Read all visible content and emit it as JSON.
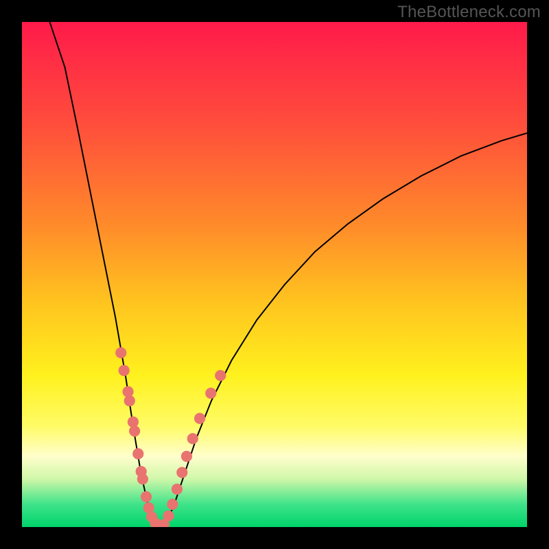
{
  "watermark": "TheBottleneck.com",
  "colors": {
    "gradient_stops": [
      {
        "pos": 0.0,
        "hex": "#ff1a4a"
      },
      {
        "pos": 0.2,
        "hex": "#ff4d3c"
      },
      {
        "pos": 0.4,
        "hex": "#ff8a2a"
      },
      {
        "pos": 0.55,
        "hex": "#ffc21f"
      },
      {
        "pos": 0.7,
        "hex": "#fff11e"
      },
      {
        "pos": 0.8,
        "hex": "#fffb66"
      },
      {
        "pos": 0.86,
        "hex": "#fffecc"
      },
      {
        "pos": 0.905,
        "hex": "#cff7a8"
      },
      {
        "pos": 0.955,
        "hex": "#3fe38a"
      },
      {
        "pos": 1.0,
        "hex": "#00d46a"
      }
    ],
    "curve": "#000000",
    "dot": "#e9736f",
    "frame": "#000000"
  },
  "chart_data": {
    "type": "line",
    "title": "",
    "xlabel": "",
    "ylabel": "",
    "xlim": [
      0,
      1
    ],
    "ylim": [
      0,
      1
    ],
    "series": [
      {
        "name": "bottleneck-curve",
        "description": "V-shaped bottleneck curve; y≈1 at x≈0, drops near-vertically to y≈0 at x≈0.26, then rises with diminishing slope toward y≈0.77 at x=1.",
        "points": [
          {
            "x": 0.055,
            "y": 1.0
          },
          {
            "x": 0.085,
            "y": 0.91
          },
          {
            "x": 0.11,
            "y": 0.79
          },
          {
            "x": 0.135,
            "y": 0.665
          },
          {
            "x": 0.16,
            "y": 0.54
          },
          {
            "x": 0.185,
            "y": 0.415
          },
          {
            "x": 0.205,
            "y": 0.3
          },
          {
            "x": 0.22,
            "y": 0.2
          },
          {
            "x": 0.235,
            "y": 0.11
          },
          {
            "x": 0.248,
            "y": 0.05
          },
          {
            "x": 0.26,
            "y": 0.01
          },
          {
            "x": 0.268,
            "y": 0.0
          },
          {
            "x": 0.282,
            "y": 0.005
          },
          {
            "x": 0.3,
            "y": 0.04
          },
          {
            "x": 0.32,
            "y": 0.1
          },
          {
            "x": 0.345,
            "y": 0.175
          },
          {
            "x": 0.375,
            "y": 0.25
          },
          {
            "x": 0.415,
            "y": 0.33
          },
          {
            "x": 0.465,
            "y": 0.41
          },
          {
            "x": 0.52,
            "y": 0.48
          },
          {
            "x": 0.58,
            "y": 0.545
          },
          {
            "x": 0.645,
            "y": 0.6
          },
          {
            "x": 0.715,
            "y": 0.65
          },
          {
            "x": 0.79,
            "y": 0.695
          },
          {
            "x": 0.87,
            "y": 0.735
          },
          {
            "x": 0.95,
            "y": 0.765
          },
          {
            "x": 1.0,
            "y": 0.78
          }
        ]
      }
    ],
    "dots": {
      "name": "sample-points",
      "radius_frac": 0.011,
      "points": [
        {
          "x": 0.196,
          "y": 0.345
        },
        {
          "x": 0.202,
          "y": 0.31
        },
        {
          "x": 0.21,
          "y": 0.268
        },
        {
          "x": 0.213,
          "y": 0.25
        },
        {
          "x": 0.22,
          "y": 0.208
        },
        {
          "x": 0.223,
          "y": 0.19
        },
        {
          "x": 0.23,
          "y": 0.145
        },
        {
          "x": 0.236,
          "y": 0.11
        },
        {
          "x": 0.239,
          "y": 0.095
        },
        {
          "x": 0.246,
          "y": 0.06
        },
        {
          "x": 0.251,
          "y": 0.038
        },
        {
          "x": 0.257,
          "y": 0.02
        },
        {
          "x": 0.264,
          "y": 0.008
        },
        {
          "x": 0.272,
          "y": 0.002
        },
        {
          "x": 0.281,
          "y": 0.005
        },
        {
          "x": 0.29,
          "y": 0.022
        },
        {
          "x": 0.298,
          "y": 0.045
        },
        {
          "x": 0.307,
          "y": 0.075
        },
        {
          "x": 0.317,
          "y": 0.108
        },
        {
          "x": 0.326,
          "y": 0.14
        },
        {
          "x": 0.338,
          "y": 0.175
        },
        {
          "x": 0.352,
          "y": 0.215
        },
        {
          "x": 0.374,
          "y": 0.265
        },
        {
          "x": 0.393,
          "y": 0.3
        }
      ]
    }
  }
}
